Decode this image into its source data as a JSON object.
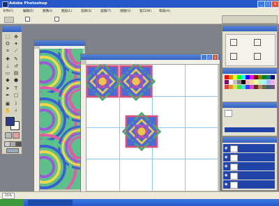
{
  "window": {
    "title": "Adobe Photoshop",
    "title_bar_color": "#2757c6",
    "controls": [
      "minimize",
      "maximize",
      "close"
    ]
  },
  "menubar": {
    "items": [
      "文件(F)",
      "编辑(E)",
      "图像(I)",
      "图层(L)",
      "选择(S)",
      "滤镜(T)",
      "视图(V)",
      "窗口(W)",
      "帮助(H)"
    ]
  },
  "options_bar": {
    "checkbox_1_label": "",
    "checkbox_2_label": ""
  },
  "toolbox": {
    "tools": [
      "marquee",
      "move",
      "lasso",
      "magic-wand",
      "crop",
      "slice",
      "healing",
      "brush",
      "stamp",
      "history-brush",
      "eraser",
      "gradient",
      "blur",
      "dodge",
      "path",
      "type",
      "pen",
      "shape",
      "notes",
      "eyedropper",
      "hand",
      "zoom"
    ],
    "foreground_color": "#2a3a8a",
    "background_color": "#ffffff"
  },
  "documents": [
    {
      "title": "",
      "pattern": "swirl-tiles",
      "colors": [
        "#e25aa8",
        "#5cc08a",
        "#3a5fd0",
        "#f0d848",
        "#9a5ad8"
      ]
    },
    {
      "title": "",
      "pattern": "kaleidoscope-tiles",
      "colors": [
        "#d8527a",
        "#4aa86a",
        "#4a6ad8",
        "#e8c850",
        "#9c54c8"
      ]
    }
  ],
  "palettes": {
    "navigator": {
      "tabs": [
        "",
        ""
      ]
    },
    "swatches": {
      "colors": [
        "#ff0000",
        "#ff8000",
        "#ffff00",
        "#00ff00",
        "#00ffff",
        "#0000ff",
        "#ff00ff",
        "#800000",
        "#808000",
        "#008000",
        "#008080",
        "#000080",
        "#800080",
        "#ffffff",
        "#c0c0c0",
        "#808080",
        "#000000",
        "#ffb0b0",
        "#ffd8a0",
        "#fff8a0",
        "#b0ffb0",
        "#a0f8ff",
        "#a8b8ff",
        "#f0a8ff",
        "#e04040",
        "#e09040",
        "#e0e040",
        "#40e040",
        "#40e0e0",
        "#4040e0",
        "#e040e0",
        "#603020",
        "#c08060",
        "#607040",
        "#406080",
        "#705080"
      ],
      "selected_color": "#2a3a8a"
    },
    "history": {
      "items": [
        "",
        "",
        ""
      ]
    },
    "channels": {
      "rows": [
        {
          "name": "",
          "shortcut": ""
        },
        {
          "name": "",
          "shortcut": ""
        },
        {
          "name": "",
          "shortcut": ""
        },
        {
          "name": "",
          "shortcut": ""
        },
        {
          "name": "",
          "shortcut": ""
        }
      ]
    }
  },
  "status_bar": {
    "zoom": "25%",
    "doc_info": "",
    "hint": ""
  },
  "taskbar": {
    "start_label": "",
    "app_label": ""
  }
}
